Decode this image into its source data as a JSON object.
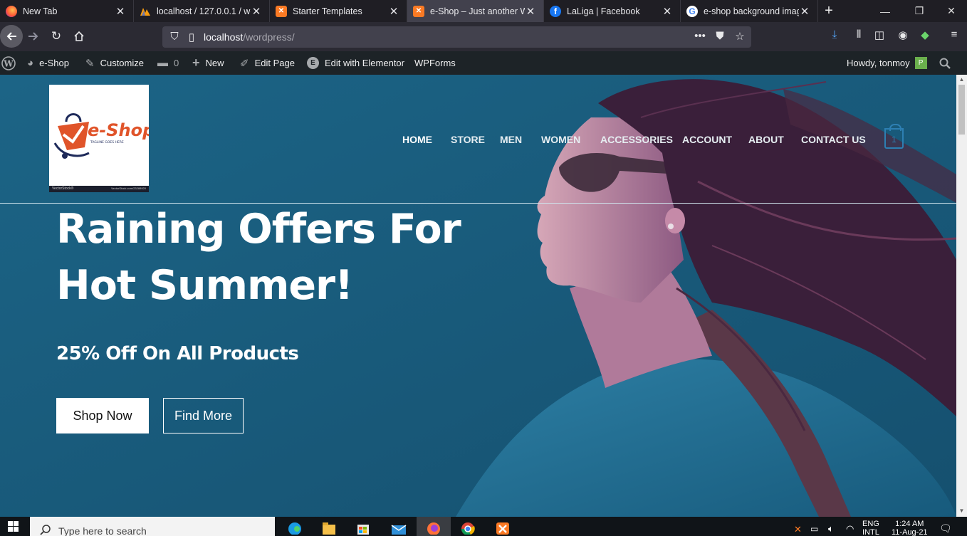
{
  "browser": {
    "tabs": [
      {
        "title": "New Tab",
        "favicon": "firefox-icon",
        "active": false
      },
      {
        "title": "localhost / 127.0.0.1 / wo",
        "favicon": "phpmyadmin-icon",
        "active": false
      },
      {
        "title": "Starter Templates",
        "favicon": "xampp-icon",
        "active": false
      },
      {
        "title": "e-Shop – Just another Wo",
        "favicon": "xampp-icon",
        "active": true
      },
      {
        "title": "LaLiga | Facebook",
        "favicon": "facebook-icon",
        "active": false
      },
      {
        "title": "e-shop background imag",
        "favicon": "google-icon",
        "active": false
      }
    ],
    "url_host": "localhost",
    "url_path": "/wordpress/",
    "colors": {
      "tabbar": "#1f1e24",
      "toolbar": "#2b2a33",
      "urlbar": "#42414d",
      "accent": "#0a84ff"
    }
  },
  "adminbar": {
    "site_name": "e-Shop",
    "customize": "Customize",
    "comments_count": "0",
    "new": "New",
    "edit_page": "Edit Page",
    "edit_elementor": "Edit with Elementor",
    "wpforms": "WPForms",
    "howdy": "Howdy, tonmoy",
    "avatar_letter": "P"
  },
  "site": {
    "logo_text": "e-Shop",
    "logo_tagline": "TAGLINE GOES HERE",
    "logo_watermark": "VectorStock®",
    "logo_watermark_id": "VectorStock.com/23288920",
    "menu": [
      "HOME",
      "STORE",
      "MEN",
      "WOMEN",
      "ACCESSORIES",
      "ACCOUNT",
      "ABOUT",
      "CONTACT US"
    ],
    "cart_count": "1",
    "headline_line1": "Raining Offers For",
    "headline_line2": "Hot Summer!",
    "subhead": "25% Off On All Products",
    "btn_primary": "Shop Now",
    "btn_secondary": "Find More",
    "colors": {
      "hero_overlay": "#1b5f7f",
      "cart_accent": "#2d7fb2",
      "logo_orange": "#e0542a",
      "logo_navy": "#1e2a5a"
    }
  },
  "taskbar": {
    "search_placeholder": "Type here to search",
    "lang_top": "ENG",
    "lang_bottom": "INTL",
    "time": "1:24 AM",
    "date": "11-Aug-21"
  }
}
